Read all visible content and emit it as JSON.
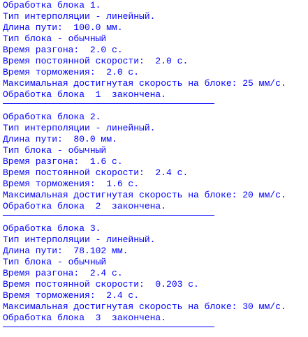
{
  "blocks": [
    {
      "lines": [
        "Обработка блока 1.",
        "Тип интерполяции - линейный.",
        "Длина пути:  100.0 мм.",
        "Тип блока - обычный",
        "Время разгона:  2.0 с.",
        "Время постоянной скорости:  2.0 с.",
        "Время торможения:  2.0 с.",
        "Максимальная достигнутая скорость на блоке: 25 мм/с.",
        "Обработка блока  1  закончена."
      ]
    },
    {
      "lines": [
        "Обработка блока 2.",
        "Тип интерполяции - линейный.",
        "Длина пути:  80.0 мм.",
        "Тип блока - обычный",
        "Время разгона:  1.6 с.",
        "Время постоянной скорости:  2.4 с.",
        "Время торможения:  1.6 с.",
        "Максимальная достигнутая скорость на блоке: 20 мм/с.",
        "Обработка блока  2  закончена."
      ]
    },
    {
      "lines": [
        "Обработка блока 3.",
        "Тип интерполяции - линейный.",
        "Длина пути:  78.102 мм.",
        "Тип блока - обычный",
        "Время разгона:  2.4 с.",
        "Время постоянной скорости:  0.203 с.",
        "Время торможения:  2.4 с.",
        "Максимальная достигнутая скорость на блоке: 30 мм/с.",
        "Обработка блока  3  закончена."
      ]
    }
  ],
  "colors": {
    "text": "#0000ff",
    "background": "#ffffff"
  }
}
